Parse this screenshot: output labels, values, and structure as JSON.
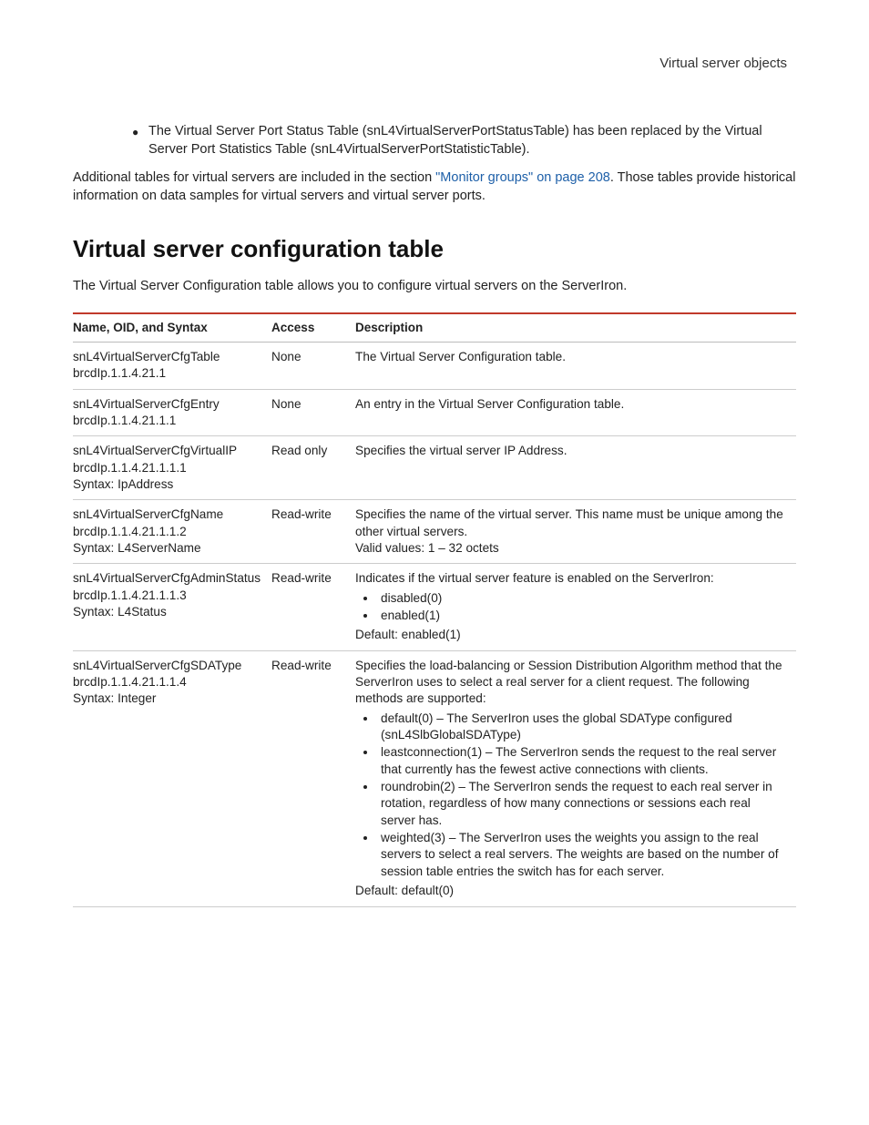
{
  "header_right": "Virtual server objects",
  "top_bullet": "The Virtual Server Port Status Table (snL4VirtualServerPortStatusTable) has been replaced by the Virtual Server Port Statistics Table (snL4VirtualServerPortStatisticTable).",
  "para_pre": "Additional tables for virtual servers are included in the section ",
  "para_link": "\"Monitor groups\" on page 208",
  "para_post": ". Those tables provide historical information on data samples for virtual servers and virtual server ports.",
  "section_title": "Virtual server configuration table",
  "section_intro": "The Virtual Server Configuration table allows you to configure virtual servers on the ServerIron.",
  "columns": {
    "c1": "Name, OID, and Syntax",
    "c2": "Access",
    "c3": "Description"
  },
  "rows": [
    {
      "name": [
        "snL4VirtualServerCfgTable",
        "brcdIp.1.1.4.21.1"
      ],
      "access": "None",
      "desc_pre": "The Virtual Server Configuration table.",
      "items": [],
      "desc_post": ""
    },
    {
      "name": [
        "snL4VirtualServerCfgEntry",
        "brcdIp.1.1.4.21.1.1"
      ],
      "access": "None",
      "desc_pre": "An entry in the Virtual Server Configuration table.",
      "items": [],
      "desc_post": ""
    },
    {
      "name": [
        "snL4VirtualServerCfgVirtualIP",
        "brcdIp.1.1.4.21.1.1.1",
        "Syntax: IpAddress"
      ],
      "access": "Read only",
      "desc_pre": "Specifies the virtual server IP Address.",
      "items": [],
      "desc_post": ""
    },
    {
      "name": [
        "snL4VirtualServerCfgName",
        "brcdIp.1.1.4.21.1.1.2",
        "Syntax: L4ServerName"
      ],
      "access": "Read-write",
      "desc_pre": "Specifies the name of the virtual server. This name must be unique among the other virtual servers.\nValid values: 1 – 32 octets",
      "items": [],
      "desc_post": ""
    },
    {
      "name": [
        "snL4VirtualServerCfgAdminStatus",
        "brcdIp.1.1.4.21.1.1.3",
        "Syntax: L4Status"
      ],
      "access": "Read-write",
      "desc_pre": "Indicates if the virtual server feature is enabled on the ServerIron:",
      "items": [
        "disabled(0)",
        "enabled(1)"
      ],
      "desc_post": "Default: enabled(1)"
    },
    {
      "name": [
        "snL4VirtualServerCfgSDAType",
        "brcdIp.1.1.4.21.1.1.4",
        "Syntax: Integer"
      ],
      "access": "Read-write",
      "desc_pre": "Specifies the load-balancing or Session Distribution Algorithm method that the ServerIron uses to select a real server for a client request. The following methods are supported:",
      "items": [
        "default(0) – The ServerIron uses the global SDAType configured (snL4SlbGlobalSDAType)",
        "leastconnection(1) – The ServerIron sends the request to the real server that currently has the fewest active connections with clients.",
        "roundrobin(2) – The ServerIron sends the request to each real server in rotation, regardless of how many connections or sessions each real server has.",
        "weighted(3) – The ServerIron uses the weights you assign to the real servers to select a real servers. The weights are based on the number of session table entries the switch has for each server."
      ],
      "desc_post": "Default: default(0)"
    }
  ]
}
